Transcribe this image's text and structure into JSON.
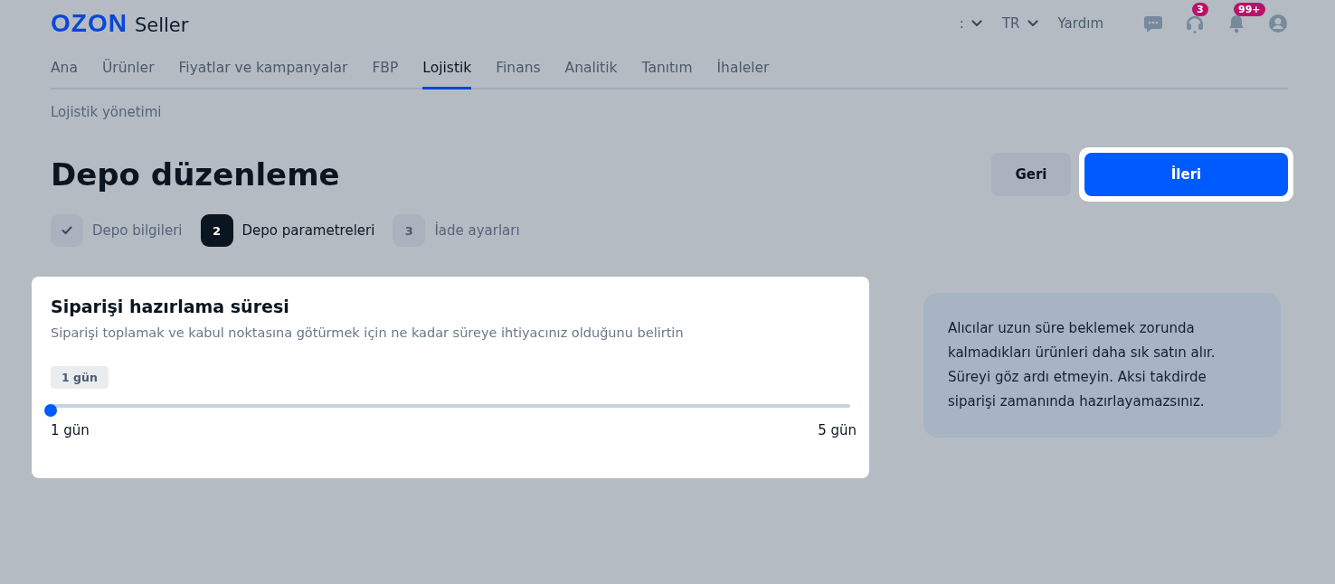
{
  "header": {
    "logo": "OZON",
    "logo_suffix": "Seller",
    "menu_dots": ":",
    "language": "TR",
    "help": "Yardım",
    "icons": [
      {
        "kind": "chat"
      },
      {
        "kind": "support",
        "badge": "3"
      },
      {
        "kind": "bell",
        "badge": "99+"
      },
      {
        "kind": "user"
      }
    ]
  },
  "nav": [
    {
      "label": "Ana",
      "selected": false
    },
    {
      "label": "Ürünler",
      "selected": false
    },
    {
      "label": "Fiyatlar ve kampanyalar",
      "selected": false
    },
    {
      "label": "FBP",
      "selected": false
    },
    {
      "label": "Lojistik",
      "selected": true
    },
    {
      "label": "Finans",
      "selected": false
    },
    {
      "label": "Analitik",
      "selected": false
    },
    {
      "label": "Tanıtım",
      "selected": false
    },
    {
      "label": "İhaleler",
      "selected": false
    }
  ],
  "breadcrumb": "Lojistik yönetimi",
  "title": "Depo düzenleme",
  "buttons": {
    "back": "Geri",
    "next": "İleri"
  },
  "steps": [
    {
      "kind": "done",
      "label": "Depo bilgileri"
    },
    {
      "kind": "current",
      "number": "2",
      "label": "Depo parametreleri"
    },
    {
      "kind": "pending",
      "number": "3",
      "label": "İade ayarları"
    }
  ],
  "card": {
    "title": "Siparişi hazırlama süresi",
    "description": "Siparişi toplamak ve kabul noktasına götürmek için ne kadar süreye ihtiyacınız olduğunu belirtin",
    "value_badge": "1 gün",
    "slider": {
      "level": 0,
      "min_label": "1 gün",
      "max_label": "5 gün"
    }
  },
  "info": "Alıcılar uzun süre beklemek zorunda kalmadıkları ürünleri daha sık satın alır. Süreyi göz ardı etmeyin. Aksi takdirde siparişi zamanında hazırlayamazsınız."
}
